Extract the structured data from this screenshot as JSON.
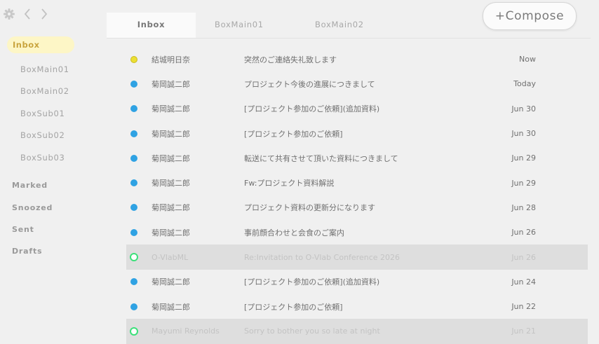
{
  "sidebar": {
    "folders": [
      {
        "label": "Inbox",
        "active": true
      },
      {
        "label": "BoxMain01"
      },
      {
        "label": "BoxMain02"
      },
      {
        "label": "BoxSub01"
      },
      {
        "label": "BoxSub02"
      },
      {
        "label": "BoxSub03"
      }
    ],
    "sections": [
      "Marked",
      "Snoozed",
      "Sent",
      "Drafts"
    ],
    "icons": [
      "gear-icon",
      "back-icon",
      "forward-icon"
    ]
  },
  "tabs": [
    "Inbox",
    "BoxMain01",
    "BoxMain02"
  ],
  "compose_label": "+Compose",
  "colors": {
    "unread_dot": "#2fa2e3",
    "important_dot": "#ecdf33",
    "read_ring": "#3ce07a",
    "active_bg": "#fdf6c6",
    "active_text": "#c9a43e"
  },
  "messages": [
    {
      "sender": "結城明日奈",
      "subject": "突然のご連絡失礼致します",
      "date": "Now",
      "status": "yellow"
    },
    {
      "sender": "菊岡誠二郎",
      "subject": "プロジェクト今後の進展につきまして",
      "date": "Today",
      "status": "blue"
    },
    {
      "sender": "菊岡誠二郎",
      "subject": "[プロジェクト参加のご依頼](追加資料)",
      "date": "Jun 30",
      "status": "blue"
    },
    {
      "sender": "菊岡誠二郎",
      "subject": "[プロジェクト参加のご依頼]",
      "date": "Jun 30",
      "status": "blue"
    },
    {
      "sender": "菊岡誠二郎",
      "subject": "転送にて共有させて頂いた資料につきまして",
      "date": "Jun 29",
      "status": "blue"
    },
    {
      "sender": "菊岡誠二郎",
      "subject": "Fw:プロジェクト資料解説",
      "date": "Jun 29",
      "status": "blue"
    },
    {
      "sender": "菊岡誠二郎",
      "subject": "プロジェクト資料の更新分になります",
      "date": "Jun 28",
      "status": "blue"
    },
    {
      "sender": "菊岡誠二郎",
      "subject": "事前顔合わせと会食のご案内",
      "date": "Jun 26",
      "status": "blue"
    },
    {
      "sender": "O-VlabML",
      "subject": "Re:Invitation to O-Vlab Conference 2026",
      "date": "Jun 26",
      "status": "read"
    },
    {
      "sender": "菊岡誠二郎",
      "subject": "[プロジェクト参加のご依頼](追加資料)",
      "date": "Jun 24",
      "status": "blue"
    },
    {
      "sender": "菊岡誠二郎",
      "subject": "[プロジェクト参加のご依頼]",
      "date": "Jun 22",
      "status": "blue"
    },
    {
      "sender": "Mayumi Reynolds",
      "subject": "Sorry to bother you so late at night",
      "date": "Jun 21",
      "status": "read"
    }
  ]
}
